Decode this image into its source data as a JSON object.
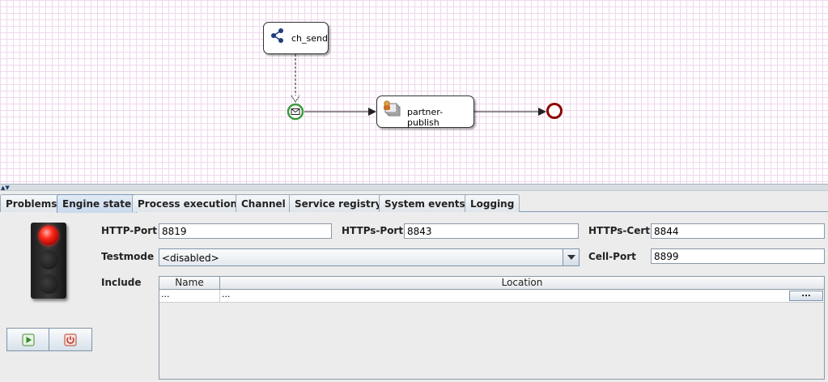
{
  "diagram": {
    "nodes": {
      "send": {
        "label": "ch_send",
        "icon": "share-icon"
      },
      "publish": {
        "label": "partner-publish",
        "icon": "service-task-icon"
      }
    },
    "start_event": {
      "icon": "message-start-event-icon"
    },
    "end_event": {
      "icon": "end-event-icon"
    }
  },
  "tabs": [
    {
      "label": "Problems"
    },
    {
      "label": "Engine state",
      "active": true
    },
    {
      "label": "Process execution"
    },
    {
      "label": "Channel"
    },
    {
      "label": "Service registry"
    },
    {
      "label": "System events"
    },
    {
      "label": "Logging"
    }
  ],
  "engine": {
    "status_light": {
      "state": "red"
    },
    "controls": {
      "start_icon": "play-icon",
      "stop_icon": "power-icon"
    },
    "http_port": {
      "label": "HTTP-Port",
      "value": "8819"
    },
    "https_port": {
      "label": "HTTPs-Port",
      "value": "8843"
    },
    "https_cert": {
      "label": "HTTPs-Cert",
      "value": "8844"
    },
    "testmode": {
      "label": "Testmode",
      "value": "<disabled>"
    },
    "cell_port": {
      "label": "Cell-Port",
      "value": "8899"
    },
    "include": {
      "label": "Include",
      "columns": [
        "Name",
        "Location"
      ],
      "rows": [
        {
          "name": "...",
          "location": "..."
        }
      ],
      "browse_label": "..."
    }
  },
  "colors": {
    "grid": "#f0d8ee",
    "start_event": "#3c9a3c",
    "end_event": "#8b0000",
    "light_red": "#ff2a1a",
    "tab_active": "#c9d9ec"
  }
}
